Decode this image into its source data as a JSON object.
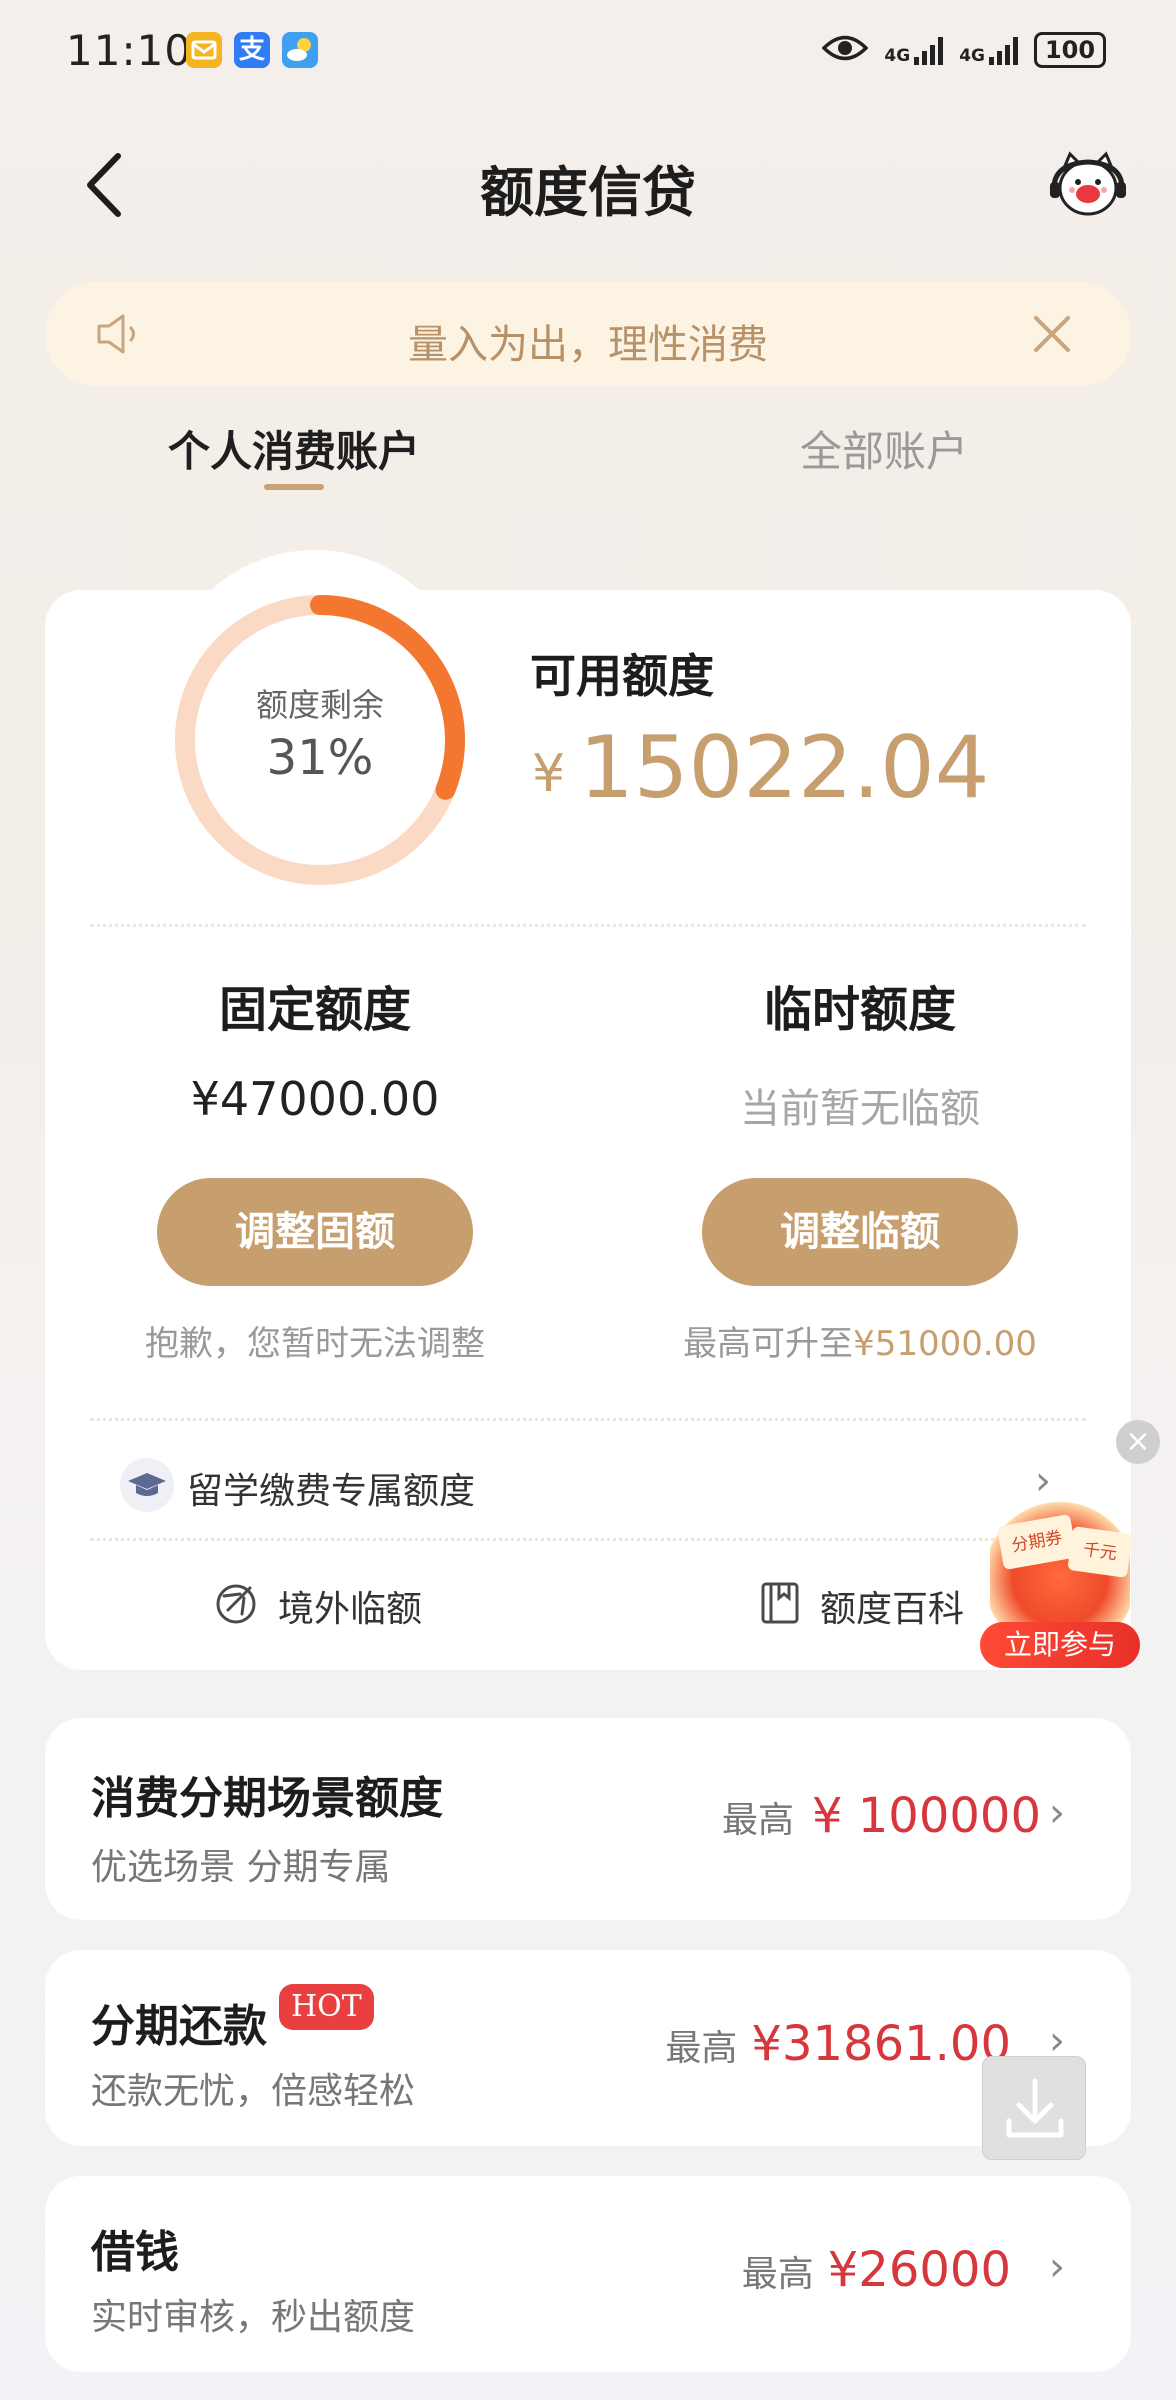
{
  "status_bar": {
    "time": "11:10",
    "alipay_glyph": "支",
    "network_1": "4G",
    "network_2": "4G",
    "battery": "100",
    "icons": [
      "mail-icon",
      "alipay-icon",
      "weather-icon",
      "eye-icon",
      "signal-icon",
      "battery-icon"
    ]
  },
  "header": {
    "title": "额度信贷",
    "back_icon": "chevron-left-icon",
    "service_icon": "customer-service-mascot-icon"
  },
  "notice": {
    "text": "量入为出，理性消费",
    "icons": [
      "speaker-icon",
      "close-icon"
    ]
  },
  "tabs": [
    {
      "label": "个人消费账户",
      "active": true
    },
    {
      "label": "全部账户",
      "active": false
    }
  ],
  "credit": {
    "ring_label": "额度剩余",
    "ring_value": "31%",
    "ring_fraction": 0.31,
    "available_label": "可用额度",
    "currency": "¥",
    "available_amount": "15022.04"
  },
  "fixed": {
    "title": "固定额度",
    "amount": "¥47000.00",
    "button": "调整固额",
    "note": "抱歉，您暂时无法调整"
  },
  "temporary": {
    "title": "临时额度",
    "status": "当前暂无临额",
    "button": "调整临额",
    "note_prefix": "最高可升至",
    "note_amount": "¥51000.00"
  },
  "study": {
    "label": "留学缴费专属额度",
    "icon": "graduation-cap-icon"
  },
  "links": {
    "overseas": "境外临额",
    "encyclopedia": "额度百科"
  },
  "promo": {
    "tag1": "分期券",
    "tag2": "千元",
    "button": "立即参与"
  },
  "list": [
    {
      "title": "消费分期场景额度",
      "subtitle": "优选场景 分期专属",
      "prefix": "最高",
      "amount": "¥ 100000"
    },
    {
      "title": "分期还款",
      "badge": "HOT",
      "subtitle": "还款无忧，倍感轻松",
      "prefix": "最高",
      "amount": "¥31861.00"
    },
    {
      "title": "借钱",
      "subtitle": "实时审核，秒出额度",
      "prefix": "最高",
      "amount": "¥26000"
    }
  ],
  "colors": {
    "accent_gold": "#c79e6d",
    "ring_active": "#f3772f",
    "ring_track": "#fbdac5",
    "amount_red": "#d7363c",
    "hot_red": "#ea3f3f"
  }
}
